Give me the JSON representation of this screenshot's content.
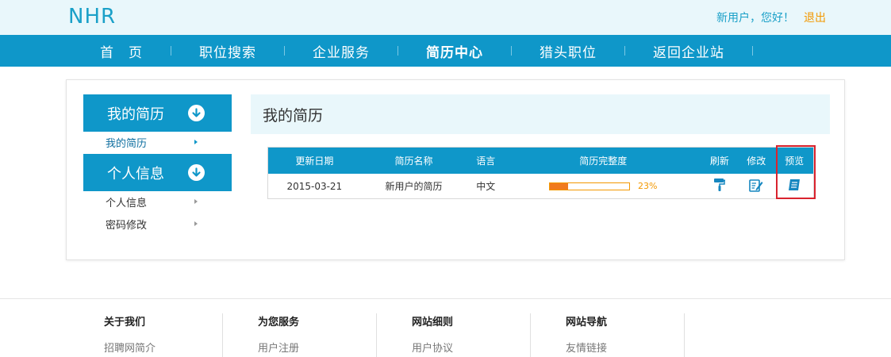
{
  "header": {
    "logo_text": "NHR",
    "greeting": "新用户，您好！",
    "logout": "退出"
  },
  "nav": {
    "items": [
      "首　页",
      "职位搜索",
      "企业服务",
      "简历中心",
      "猎头职位",
      "返回企业站"
    ],
    "active_index": 3
  },
  "sidebar": {
    "sections": [
      {
        "title": "我的简历",
        "items": [
          "我的简历"
        ]
      },
      {
        "title": "个人信息",
        "items": [
          "个人信息",
          "密码修改"
        ]
      }
    ]
  },
  "content": {
    "title": "我的简历",
    "table": {
      "headers": [
        "更新日期",
        "简历名称",
        "语言",
        "简历完整度",
        "刷新",
        "修改",
        "预览"
      ],
      "rows": [
        {
          "date": "2015-03-21",
          "name": "新用户的简历",
          "language": "中文",
          "completeness": 23,
          "completeness_text": "23%"
        }
      ]
    }
  },
  "footer": {
    "columns": [
      {
        "title": "关于我们",
        "link": "招聘网简介"
      },
      {
        "title": "为您服务",
        "link": "用户注册"
      },
      {
        "title": "网站细则",
        "link": "用户协议"
      },
      {
        "title": "网站导航",
        "link": "友情链接"
      }
    ]
  },
  "colors": {
    "primary": "#0f97c9",
    "header_bg": "#e9f7fb",
    "accent": "#f39800",
    "highlight": "#d9232e"
  },
  "icons": [
    "down-arrow-circle-icon",
    "paint-roller-icon",
    "edit-icon",
    "preview-icon",
    "caret-right-icon"
  ]
}
